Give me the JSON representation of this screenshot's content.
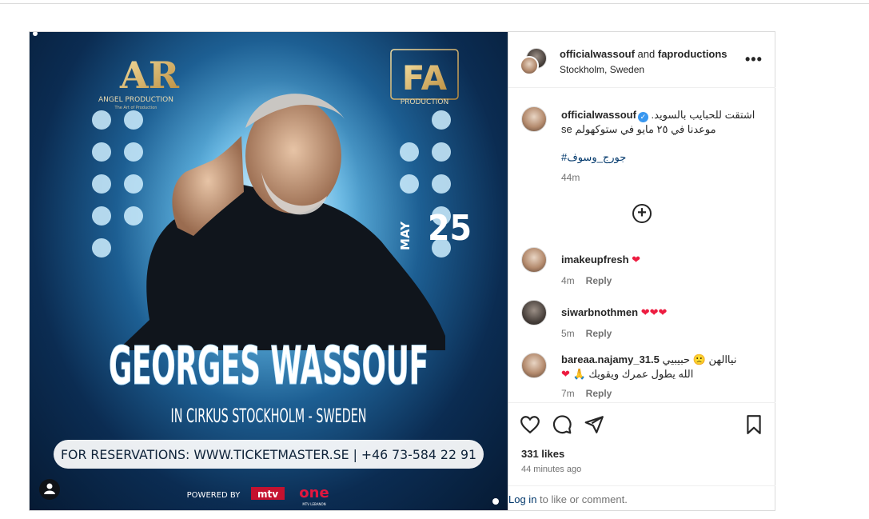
{
  "post": {
    "header": {
      "owner": "officialwassouf",
      "joiner": "and",
      "collaborator": "faproductions",
      "location": "Stockholm, Sweden",
      "more": "•••"
    },
    "poster": {
      "brand_left_mark": "AR",
      "brand_left": "ANGEL PRODUCTION",
      "brand_left_tagline": "The Art of Production",
      "brand_right_mark": "FA",
      "brand_right": "PRODUCTION",
      "date_month": "MAY",
      "date_day": "25",
      "artist": "GEORGES WASSOUF",
      "venue": "IN CIRKUS STOCKHOLM - SWEDEN",
      "reservations": "FOR RESERVATIONS: WWW.TICKETMASTER.SE  | +46 73-584 22 91",
      "powered_by": "POWERED BY",
      "sponsor_1": "mtv",
      "sponsor_2": "one",
      "sponsor_2_sub": "MTV LEBANON"
    },
    "caption": {
      "user": "officialwassouf",
      "verified_mark": "✓",
      "line1": "اشتقت للحبايب بالسويد.",
      "line2": "موعدنا في ٢٥ مايو في ستوكهولم se",
      "hashtag": "#جورج_وسوف",
      "time": "44m"
    },
    "load_more": "+",
    "comments": [
      {
        "user": "imakeupfresh",
        "text": "",
        "emoji": "❤",
        "time": "4m",
        "reply": "Reply"
      },
      {
        "user": "siwarbnothmen",
        "text": "",
        "emoji": "❤❤❤",
        "time": "5m",
        "reply": "Reply"
      },
      {
        "user": "bareaa.najamy_31.5",
        "text": "نياالهن 🙁 حبيبيي",
        "text2": "الله يطول عمرك ويقويك 🙏",
        "emoji": "❤",
        "time": "7m",
        "reply": "Reply"
      }
    ],
    "likes": "331 likes",
    "posted_ago": "44 minutes ago",
    "login_link": "Log in",
    "login_rest": " to like or comment."
  }
}
